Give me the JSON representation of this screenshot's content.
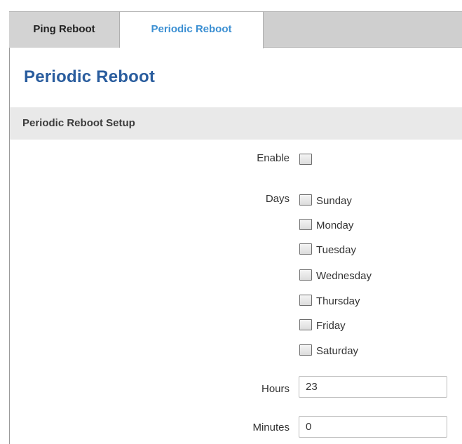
{
  "tabs": [
    {
      "label": "Ping Reboot",
      "active": false
    },
    {
      "label": "Periodic Reboot",
      "active": true
    }
  ],
  "page": {
    "title": "Periodic Reboot"
  },
  "section": {
    "title": "Periodic Reboot Setup"
  },
  "form": {
    "enable": {
      "label": "Enable",
      "checked": false
    },
    "days": {
      "label": "Days",
      "options": [
        {
          "label": "Sunday",
          "checked": false
        },
        {
          "label": "Monday",
          "checked": false
        },
        {
          "label": "Tuesday",
          "checked": false
        },
        {
          "label": "Wednesday",
          "checked": false
        },
        {
          "label": "Thursday",
          "checked": false
        },
        {
          "label": "Friday",
          "checked": false
        },
        {
          "label": "Saturday",
          "checked": false
        }
      ]
    },
    "hours": {
      "label": "Hours",
      "value": "23"
    },
    "minutes": {
      "label": "Minutes",
      "value": "0"
    }
  },
  "colors": {
    "active_tab_text": "#3b8fd2",
    "title_text": "#2a5d9e",
    "tab_bar_bg": "#cfcfcf",
    "section_bg": "#e9e9e9"
  }
}
